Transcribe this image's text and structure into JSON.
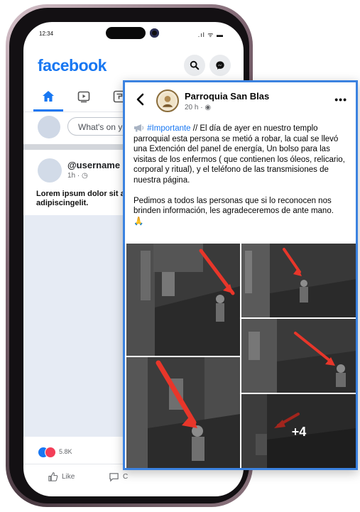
{
  "phone": {
    "status": {
      "time": "12:34",
      "signal": ".ıl ᯤ ▬"
    },
    "app_name": "facebook",
    "composer_placeholder": "What's on yo",
    "post": {
      "username": "@username",
      "meta": "1h · ◷",
      "body": "Lorem ipsum dolor sit a adipiscingelit."
    },
    "reaction_count": "5.8K",
    "actions": {
      "like": "Like",
      "comment": "C"
    }
  },
  "card": {
    "page_name": "Parroquia San Blas",
    "meta": "20 h · ◉",
    "more": "•••",
    "hashtag": "#Importante",
    "paragraph1_rest": " // El día de ayer en nuestro templo parroquial esta persona se metió a robar, la cual se llevó una Extención del panel de energía, Un bolso para las visitas de los enfermos ( que contienen los óleos, relicario, corporal y ritual), y el teléfono de las transmisiones de nuestra página.",
    "paragraph2": "Pedimos a todos las personas que si lo reconocen nos brinden información, les agradeceremos de ante mano.",
    "emoji": "🙏",
    "more_photos": "+4",
    "icons": [
      "back-arrow-icon",
      "megaphone-icon",
      "globe-icon",
      "more-icon"
    ]
  },
  "colors": {
    "brand": "#1877f2",
    "card_border": "#3b82e0",
    "arrow": "#e8362a"
  }
}
